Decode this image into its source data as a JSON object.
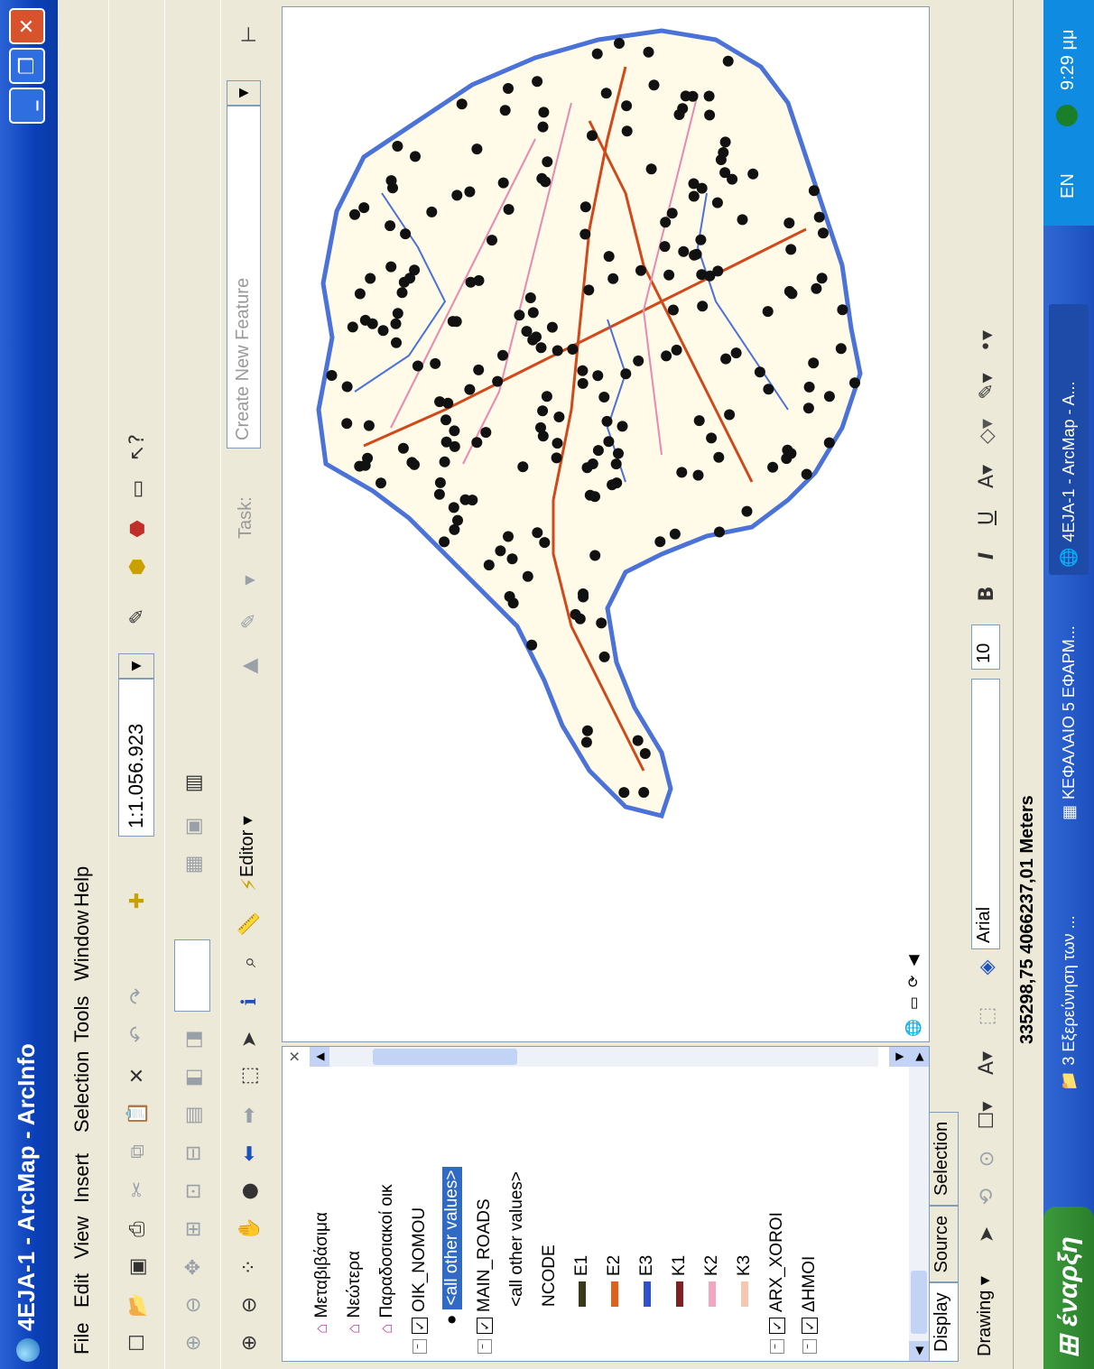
{
  "window": {
    "title": "4EJA-1 - ArcMap - ArcInfo",
    "minimize": "_",
    "restore": "❐",
    "close": "✕"
  },
  "menu": [
    "File",
    "Edit",
    "View",
    "Insert",
    "Selection",
    "Tools",
    "Window",
    "Help"
  ],
  "standard_toolbar": {
    "scale_value": "1:1.056.923"
  },
  "editor_toolbar": {
    "editor_label": "Editor ▾",
    "task_label": "Task:",
    "task_value": "Create New Feature"
  },
  "toc": {
    "items": [
      {
        "label": "Μεταβιβάσιμα",
        "kind": "group"
      },
      {
        "label": "Νεώτερα",
        "kind": "group"
      },
      {
        "label": "Παραδοσιακοί οικ",
        "kind": "group"
      },
      {
        "label": "OIK_NOMOU",
        "kind": "layer",
        "checked": true
      },
      {
        "label": "<all other values>",
        "kind": "selected"
      },
      {
        "label": "MAIN_ROADS",
        "kind": "layer",
        "checked": true
      },
      {
        "label": "<all other values>",
        "kind": "legend"
      },
      {
        "label": "NCODE",
        "kind": "heading"
      },
      {
        "label": "E1",
        "kind": "legend",
        "color": "#3a3a1a"
      },
      {
        "label": "E2",
        "kind": "legend",
        "color": "#e0601c"
      },
      {
        "label": "E3",
        "kind": "legend",
        "color": "#3050d0"
      },
      {
        "label": "K1",
        "kind": "legend",
        "color": "#802020"
      },
      {
        "label": "K2",
        "kind": "legend",
        "color": "#f4a6c0"
      },
      {
        "label": "K3",
        "kind": "legend",
        "color": "#f6c7b0"
      },
      {
        "label": "ARX_XOROI",
        "kind": "layer",
        "checked": true
      },
      {
        "label": "ΔΗΜΟΙ",
        "kind": "layer",
        "checked": true
      }
    ],
    "tabs": [
      "Display",
      "Source",
      "Selection"
    ]
  },
  "map": {
    "land_color": "#fffbe8",
    "boundary_color": "#4a72d8",
    "road_color_main": "#d0491a",
    "road_color_minor": "#e88ab0",
    "point_color": "#111111"
  },
  "draw_toolbar": {
    "drawing_label": "Drawing ▾",
    "font_name": "Arial",
    "font_size": "10",
    "bold": "B",
    "italic": "I",
    "underline": "U"
  },
  "status": {
    "coords": "335298,75  4066237,01 Meters"
  },
  "taskbar": {
    "start": "έναρξη",
    "items": [
      {
        "label": "3 Εξερεύνηση των ..."
      },
      {
        "label": "ΚΕΦΑΛΑΙΟ 5 ΕΦΑΡΜ..."
      },
      {
        "label": "4EJA-1 - ArcMap - A...",
        "active": true
      }
    ],
    "lang": "EN",
    "time": "9:29 μμ"
  }
}
